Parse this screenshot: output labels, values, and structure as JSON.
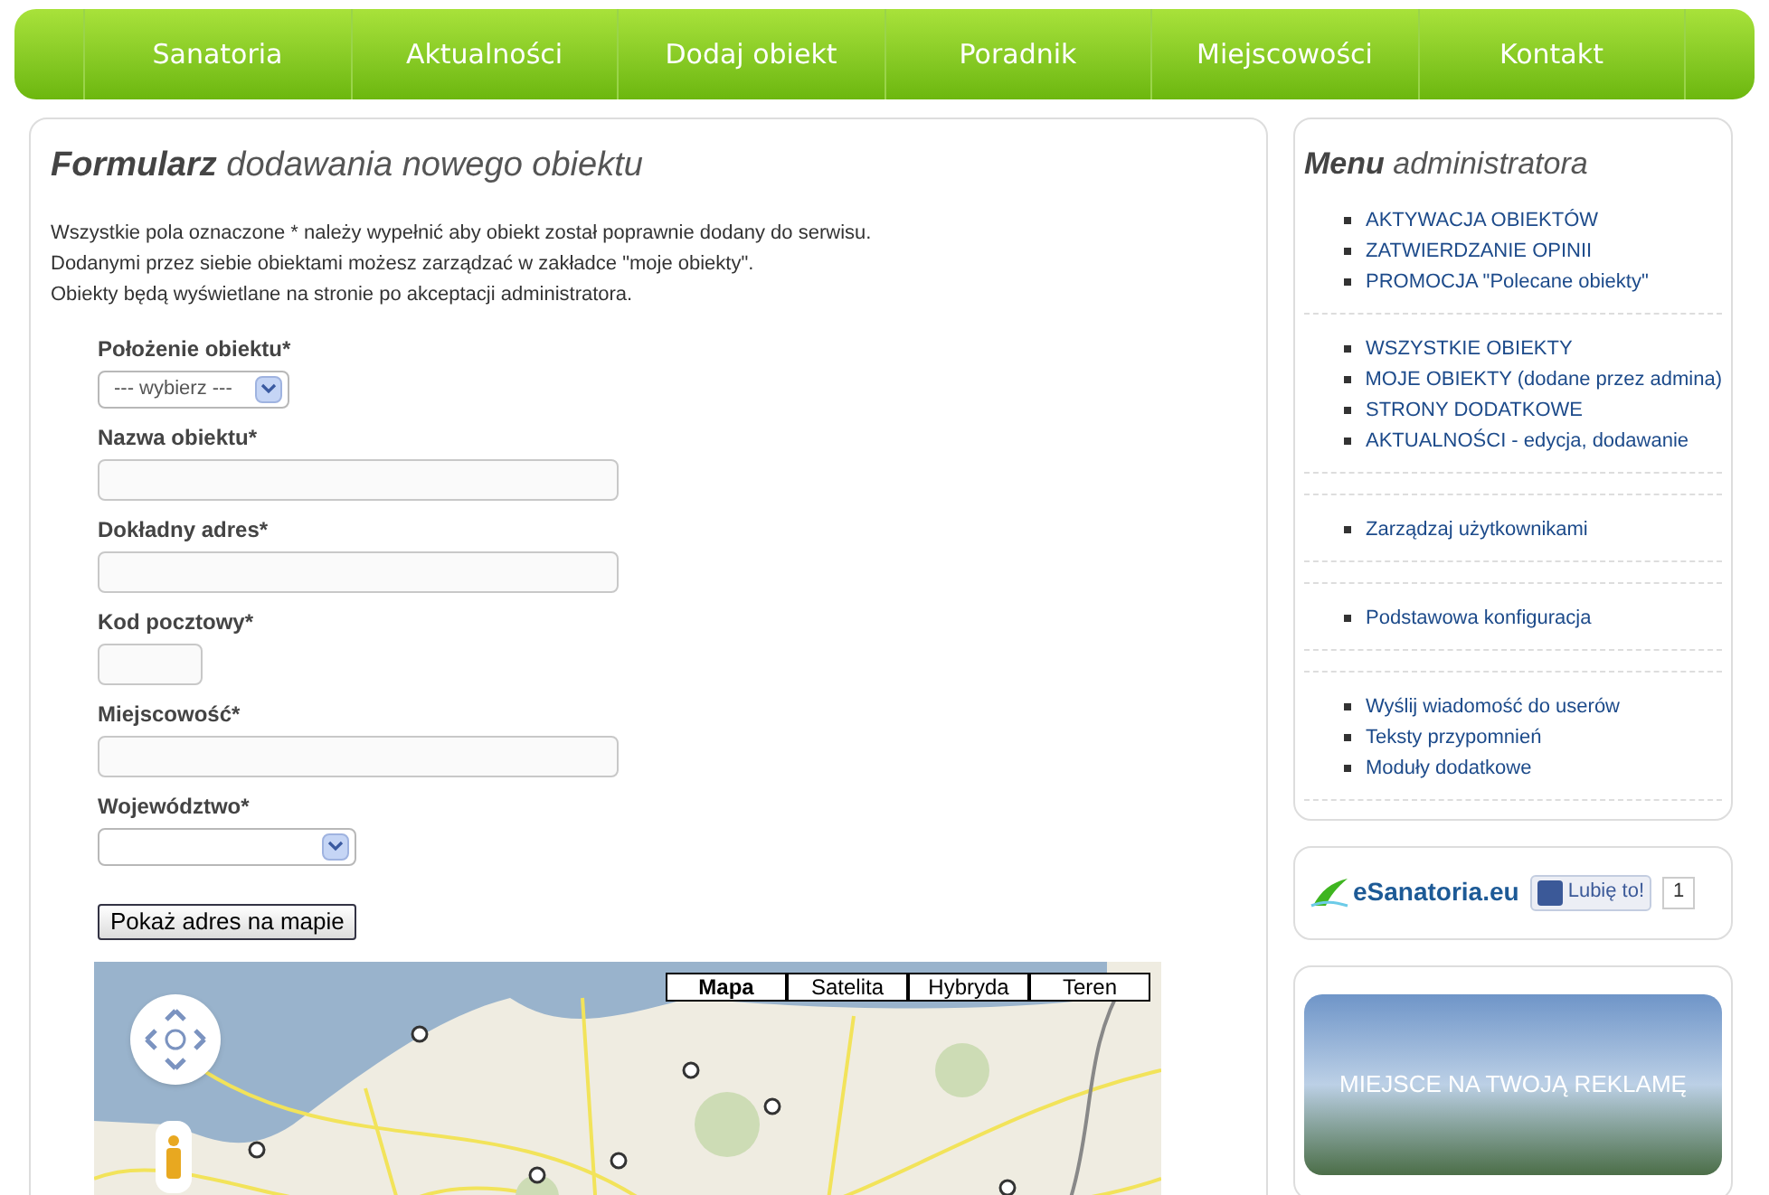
{
  "nav": [
    {
      "label": "Sanatoria"
    },
    {
      "label": "Aktualności"
    },
    {
      "label": "Dodaj obiekt"
    },
    {
      "label": "Poradnik"
    },
    {
      "label": "Miejscowości"
    },
    {
      "label": "Kontakt"
    }
  ],
  "form": {
    "title_bold": "Formularz",
    "title_rest": "dodawania nowego obiektu",
    "intro": [
      "Wszystkie pola oznaczone * należy wypełnić aby obiekt został poprawnie dodany do serwisu.",
      "Dodanymi przez siebie obiektami możesz zarządzać w zakładce \"moje obiekty\".",
      "Obiekty będą wyświetlane na stronie po akceptacji administratora."
    ],
    "fields": [
      {
        "kind": "select",
        "label": "Położenie obiektu*",
        "value": "--- wybierz ---"
      },
      {
        "kind": "text",
        "label": "Nazwa obiektu*"
      },
      {
        "kind": "text",
        "label": "Dokładny adres*"
      },
      {
        "kind": "text",
        "label": "Kod pocztowy*"
      },
      {
        "kind": "text",
        "label": "Miejscowość*"
      },
      {
        "kind": "select",
        "label": "Województwo*"
      }
    ],
    "button": "Pokaż adres na mapie"
  },
  "map": {
    "types": [
      {
        "label": "Mapa",
        "selected": true
      },
      {
        "label": "Satelita",
        "selected": false
      },
      {
        "label": "Hybryda",
        "selected": false
      },
      {
        "label": "Teren",
        "selected": false
      }
    ]
  },
  "admin_menu": {
    "title_bold": "Menu",
    "title_rest": "administratora",
    "groups": [
      {
        "items": [
          "AKTYWACJA OBIEKTÓW",
          "ZATWIERDZANIE OPINII",
          "PROMOCJA \"Polecane obiekty\""
        ]
      },
      {
        "items": [
          "WSZYSTKIE OBIEKTY",
          "MOJE OBIEKTY (dodane przez admina)",
          "STRONY DODATKOWE",
          "AKTUALNOŚCI - edycja, dodawanie"
        ]
      },
      {
        "items": [
          "Zarządzaj użytkownikami"
        ]
      },
      {
        "items": [
          "Podstawowa konfiguracja"
        ]
      },
      {
        "items": [
          "Wyślij wiadomość do userów",
          "Teksty przypomnień",
          "Moduły dodatkowe"
        ]
      }
    ]
  },
  "like_box": {
    "logo": "eSanatoria.eu",
    "like_button": "Lubię to!",
    "count": "1"
  },
  "ad": {
    "text": "MIEJSCE NA TWOJĄ REKLAMĘ"
  }
}
